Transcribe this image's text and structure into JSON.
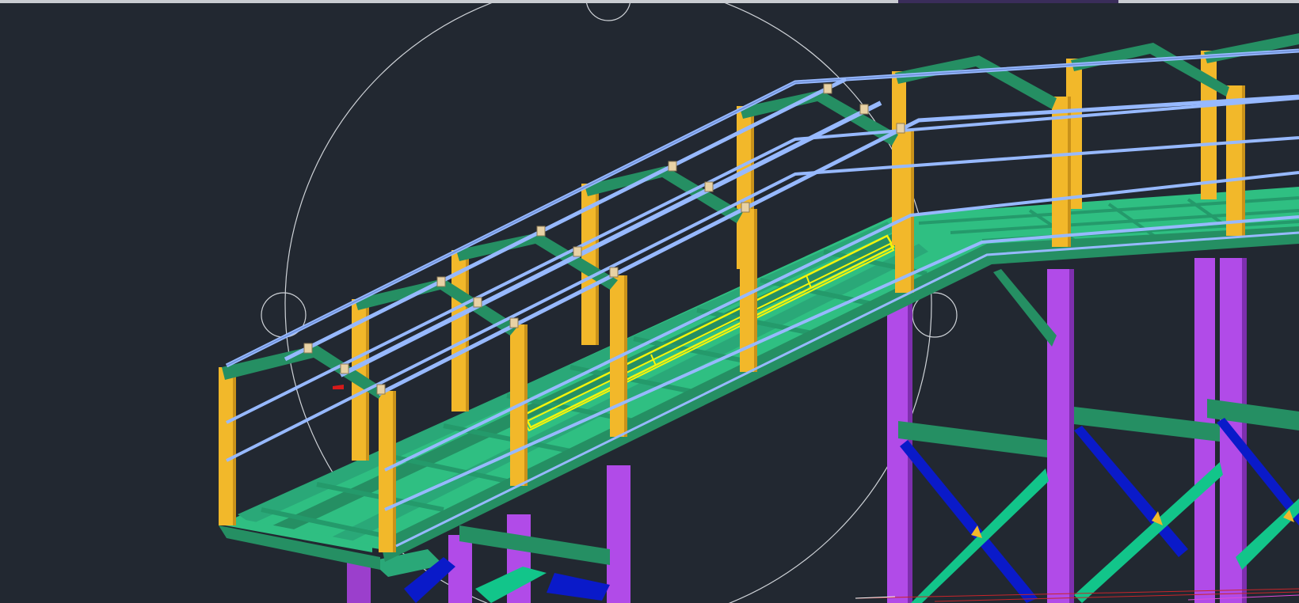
{
  "window": {
    "title": ""
  },
  "viewport": {
    "background": "#222831"
  },
  "colors": {
    "column_yellow": "#f2b82a",
    "beam_green": "#2aa878",
    "deck_green": "#2fbf82",
    "rail_blue": "#97b9ff",
    "post_purple": "#b14be8",
    "brace_blue": "#0a1ac9",
    "brace_teal": "#12c58a",
    "highlight_yellow": "#f5f50b",
    "orbit_circle": "#cfd3d8",
    "bolt_tan": "#e8d2a5"
  },
  "icons": {
    "orbit_handle_top": "orbit-top-handle-icon",
    "orbit_handle_left": "orbit-left-handle-icon",
    "orbit_handle_right": "orbit-right-handle-icon"
  }
}
